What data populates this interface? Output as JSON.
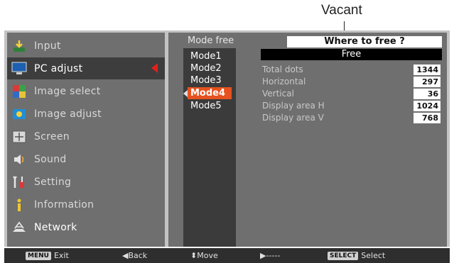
{
  "callout": {
    "text": "Vacant"
  },
  "menu": {
    "items": [
      {
        "label": "Input",
        "icon": "input-icon"
      },
      {
        "label": "PC adjust",
        "icon": "pc-adjust-icon"
      },
      {
        "label": "Image select",
        "icon": "image-select-icon"
      },
      {
        "label": "Image adjust",
        "icon": "image-adjust-icon"
      },
      {
        "label": "Screen",
        "icon": "screen-icon"
      },
      {
        "label": "Sound",
        "icon": "sound-icon"
      },
      {
        "label": "Setting",
        "icon": "setting-icon"
      },
      {
        "label": "Information",
        "icon": "information-icon"
      },
      {
        "label": "Network",
        "icon": "network-icon"
      }
    ]
  },
  "panel": {
    "heading": "Mode free",
    "where_label": "Where to free ?",
    "free_label": "Free",
    "modes": [
      "Mode1",
      "Mode2",
      "Mode3",
      "Mode4",
      "Mode5"
    ],
    "selected_mode": "Mode4",
    "rows": [
      {
        "label": "Total dots",
        "value": "1344"
      },
      {
        "label": "Horizontal",
        "value": "297"
      },
      {
        "label": "Vertical",
        "value": "36"
      },
      {
        "label": "Display area H",
        "value": "1024"
      },
      {
        "label": "Display area V",
        "value": "768"
      }
    ]
  },
  "footer": {
    "menu_key": "MENU",
    "exit": "Exit",
    "back": "◀Back",
    "move": "⬍Move",
    "dashes": "▶-----",
    "select_key": "SELECT",
    "select": "Select"
  },
  "colors": {
    "accent": "#e6521f",
    "arrow": "#e0201c"
  }
}
